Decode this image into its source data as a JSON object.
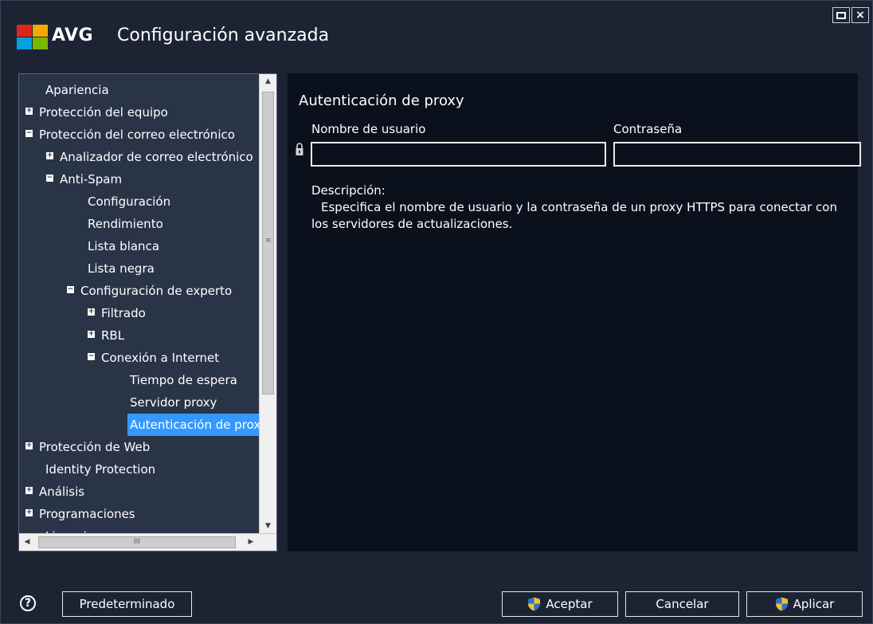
{
  "window": {
    "brand": "AVG",
    "title": "Configuración avanzada",
    "brand_colors": [
      "#e2231a",
      "#f6a800",
      "#00a1de",
      "#7ab800"
    ]
  },
  "tree": {
    "items": [
      {
        "label": "Apariencia",
        "expander": "none"
      },
      {
        "label": "Protección del equipo",
        "expander": "plus"
      },
      {
        "label": "Protección del correo electrónico",
        "expander": "minus"
      },
      {
        "label": "Analizador de correo electrónico",
        "expander": "plus"
      },
      {
        "label": "Anti-Spam",
        "expander": "minus"
      },
      {
        "label": "Configuración",
        "expander": "none"
      },
      {
        "label": "Rendimiento",
        "expander": "none"
      },
      {
        "label": "Lista blanca",
        "expander": "none"
      },
      {
        "label": "Lista negra",
        "expander": "none"
      },
      {
        "label": "Configuración de experto",
        "expander": "minus"
      },
      {
        "label": "Filtrado",
        "expander": "plus"
      },
      {
        "label": "RBL",
        "expander": "plus"
      },
      {
        "label": "Conexión a Internet",
        "expander": "minus"
      },
      {
        "label": "Tiempo de espera",
        "expander": "none"
      },
      {
        "label": "Servidor proxy",
        "expander": "none"
      },
      {
        "label": "Autenticación de proxy",
        "expander": "none",
        "selected": true
      },
      {
        "label": "Protección de Web",
        "expander": "plus"
      },
      {
        "label": "Identity Protection",
        "expander": "none"
      },
      {
        "label": "Análisis",
        "expander": "plus"
      },
      {
        "label": "Programaciones",
        "expander": "plus"
      },
      {
        "label": "Licencia",
        "expander": "none"
      }
    ],
    "selection_color": "#3399ff"
  },
  "content": {
    "section_title": "Autenticación de proxy",
    "username_label": "Nombre de usuario",
    "username_value": "",
    "password_label": "Contraseña",
    "password_value": "",
    "description_label": "Descripción:",
    "description_text": "Especifica el nombre de usuario y la contraseña de un proxy HTTPS para conectar con los servidores de actualizaciones."
  },
  "footer": {
    "help_icon": "?",
    "default_button": "Predeterminado",
    "accept_button": "Aceptar",
    "cancel_button": "Cancelar",
    "apply_button": "Aplicar"
  }
}
